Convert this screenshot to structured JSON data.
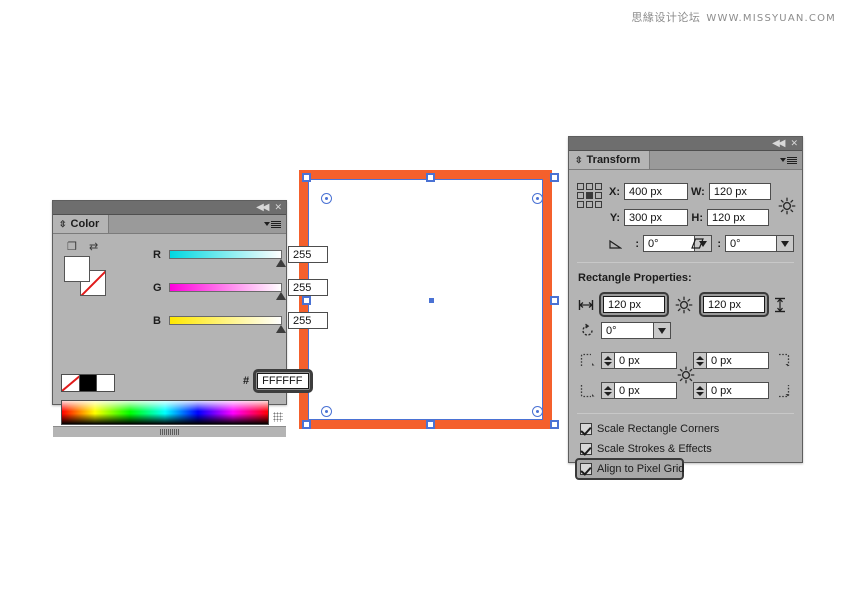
{
  "watermark": {
    "cn": "思緣设计论坛",
    "url": "WWW.MISSYUAN.COM"
  },
  "color_panel": {
    "tab_label": "Color",
    "titlebar": {
      "collapse_icon": "double-chevron-left-icon",
      "close_icon": "close-icon"
    },
    "menu_icon": "panel-menu-icon",
    "fill_stroke": {
      "default_icon": "default-fill-stroke-icon",
      "swap_icon": "swap-fill-stroke-icon",
      "fill_color": "#FFFFFF",
      "stroke_color": "none"
    },
    "sliders": [
      {
        "label": "R",
        "value": "255",
        "from": "#00d8e0",
        "to": "#ffffff"
      },
      {
        "label": "G",
        "value": "255",
        "from": "#ff00dc",
        "to": "#ffffff"
      },
      {
        "label": "B",
        "value": "255",
        "from": "#ffe800",
        "to": "#ffffff"
      }
    ],
    "mini_swatches": [
      "none",
      "#000000",
      "#FFFFFF"
    ],
    "hex": {
      "label": "#",
      "value": "FFFFFF",
      "highlighted": true
    },
    "spectrum_label": "color-spectrum-ramp"
  },
  "transform_panel": {
    "tab_label": "Transform",
    "titlebar": {
      "collapse_icon": "double-chevron-left-icon",
      "close_icon": "close-icon"
    },
    "menu_icon": "panel-menu-icon",
    "reference_point": "center",
    "fields": {
      "x_label": "X:",
      "x_value": "400 px",
      "y_label": "Y:",
      "y_value": "300 px",
      "w_label": "W:",
      "w_value": "120 px",
      "h_label": "H:",
      "h_value": "120 px",
      "rotate_label": "rotate-angle-icon",
      "rotate_value": "0°",
      "shear_label": "shear-angle-icon",
      "shear_value": "0°",
      "constrain_icon": "constrain-wh-proportions-icon"
    },
    "section_title": "Rectangle Properties:",
    "rect_props": {
      "width_icon": "rect-width-icon",
      "width_value": "120 px",
      "width_highlighted": true,
      "link_icon": "link-wh-icon",
      "height_value": "120 px",
      "height_highlighted": true,
      "height_icon": "rect-height-icon",
      "angle_icon": "rect-rotate-icon",
      "angle_value": "0°"
    },
    "corner_radii": [
      {
        "icon": "corner-top-left-icon",
        "value": "0 px"
      },
      {
        "icon": "corner-top-right-icon",
        "value": "0 px"
      },
      {
        "icon": "corner-bottom-left-icon",
        "value": "0 px"
      },
      {
        "icon": "corner-bottom-right-icon",
        "value": "0 px"
      }
    ],
    "corner_link_icon": "link-corners-icon",
    "checkboxes": [
      {
        "label": "Scale Rectangle Corners",
        "checked": true,
        "highlighted": false
      },
      {
        "label": "Scale Strokes & Effects",
        "checked": true,
        "highlighted": false
      },
      {
        "label": "Align to Pixel Grid",
        "checked": true,
        "highlighted": true
      }
    ]
  },
  "artwork": {
    "name": "selected-rectangle",
    "fill": "#FFFFFF",
    "stroke": "#F4602C",
    "selection_color": "#4A72D4",
    "handles": 8,
    "live_corner_widgets": 4
  }
}
